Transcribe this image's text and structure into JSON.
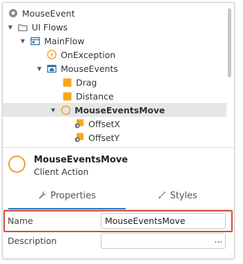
{
  "tree": {
    "items": [
      {
        "label": "MouseEvent",
        "arrow": "",
        "icon": "module-icon",
        "bold": false
      },
      {
        "label": "UI Flows",
        "arrow": "▼",
        "icon": "folder-icon",
        "bold": false
      },
      {
        "label": "MainFlow",
        "arrow": "▼",
        "icon": "flow-icon",
        "bold": false
      },
      {
        "label": "OnException",
        "arrow": "",
        "icon": "exception-icon",
        "bold": false
      },
      {
        "label": "MouseEvents",
        "arrow": "▼",
        "icon": "screen-icon",
        "bold": false
      },
      {
        "label": "Drag",
        "arrow": "",
        "icon": "block-icon",
        "bold": false
      },
      {
        "label": "Distance",
        "arrow": "",
        "icon": "block-icon",
        "bold": false
      },
      {
        "label": "MouseEventsMove",
        "arrow": "▼",
        "icon": "client-action-icon",
        "bold": true
      },
      {
        "label": "OffsetX",
        "arrow": "",
        "icon": "input-param-icon",
        "bold": false
      },
      {
        "label": "OffsetY",
        "arrow": "",
        "icon": "input-param-icon",
        "bold": false
      }
    ]
  },
  "element": {
    "name": "MouseEventsMove",
    "type": "Client Action"
  },
  "tabs": {
    "properties": "Properties",
    "styles": "Styles"
  },
  "properties": {
    "name_label": "Name",
    "name_value": "MouseEventsMove",
    "description_label": "Description",
    "description_value": "",
    "more": "..."
  },
  "colors": {
    "accent": "#1a7fd1",
    "highlight": "#d14b3a",
    "action": "#f0a030"
  }
}
